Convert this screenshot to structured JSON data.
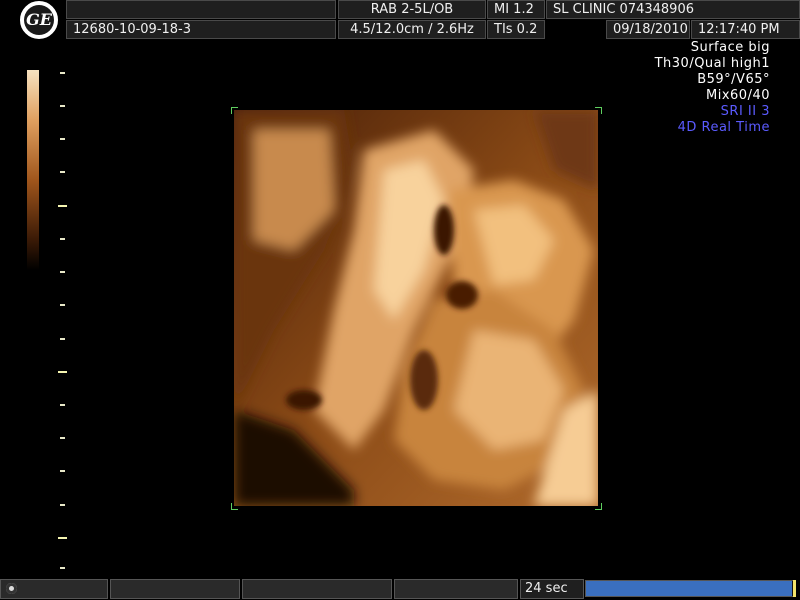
{
  "header": {
    "probe": "RAB 2-5L/OB",
    "mi": "MI 1.2",
    "clinic": "SL CLINIC 074348906",
    "patient_id": "12680-10-09-18-3",
    "depth_freq": "4.5/12.0cm / 2.6Hz",
    "tis": "TIs 0.2",
    "date": "09/18/2010",
    "time": "12:17:40 PM",
    "logo_text": "GE"
  },
  "params": {
    "lines": [
      "Surface big",
      "Th30/Qual high1",
      "B59°/V65°",
      "Mix60/40"
    ],
    "highlight_lines": [
      "SRI II 3",
      "4D Real Time"
    ],
    "highlight_color": "#5b5bff"
  },
  "bottom": {
    "timer": "24 sec",
    "progress_fraction": 0.99,
    "progress_color": "#3a6fbf"
  }
}
